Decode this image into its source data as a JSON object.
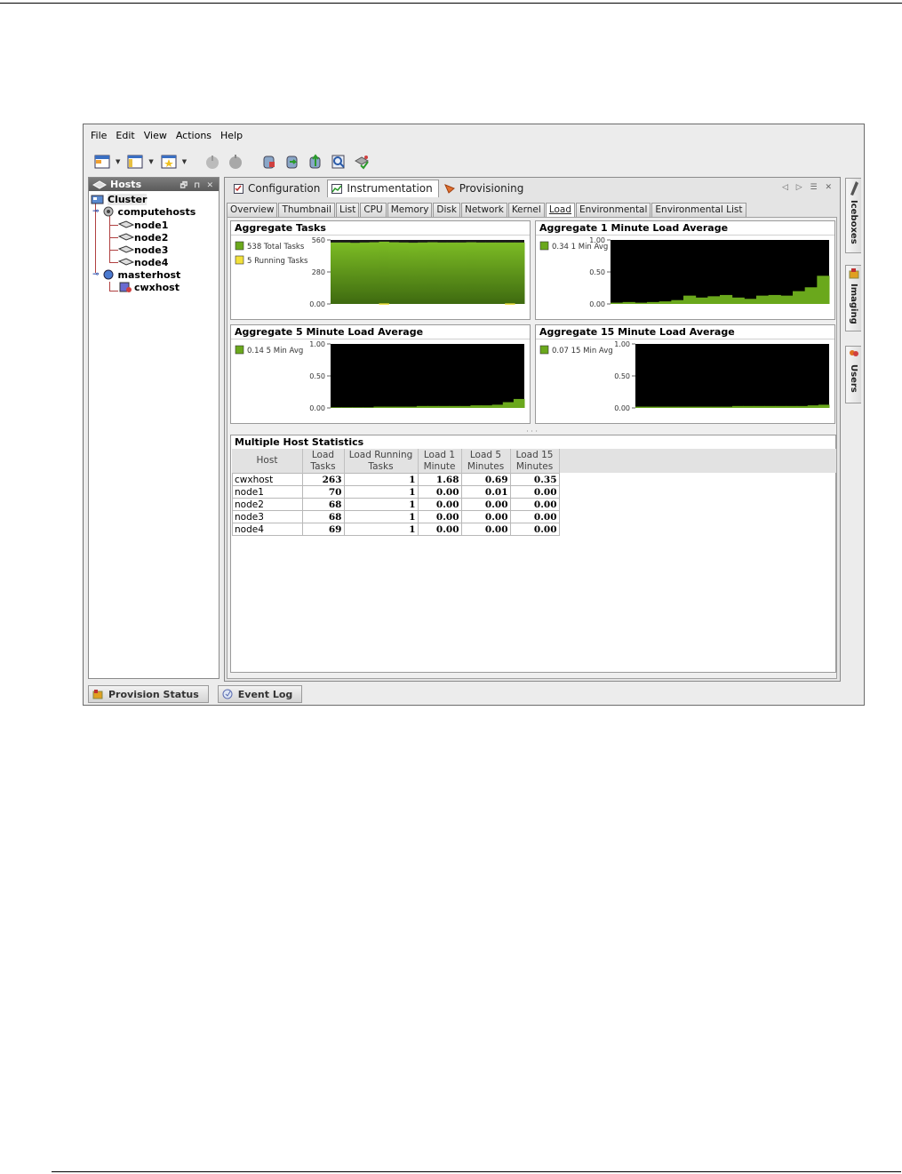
{
  "menu": [
    "File",
    "Edit",
    "View",
    "Actions",
    "Help"
  ],
  "hosts_panel": {
    "title": "Hosts",
    "tree": {
      "root": "Cluster",
      "group": "computehosts",
      "nodes": [
        "node1",
        "node2",
        "node3",
        "node4"
      ],
      "master": "masterhost",
      "master_child": "cwxhost"
    }
  },
  "view_tabs": [
    "Configuration",
    "Instrumentation",
    "Provisioning"
  ],
  "active_view_tab": "Instrumentation",
  "sub_tabs": [
    "Overview",
    "Thumbnail",
    "List",
    "CPU",
    "Memory",
    "Disk",
    "Network",
    "Kernel",
    "Load",
    "Environmental",
    "Environmental List"
  ],
  "active_sub_tab": "Load",
  "colors": {
    "series_green": "#6aa81c",
    "series_yellow": "#f2e03a",
    "plot_bg": "#000000"
  },
  "chart_data": [
    {
      "type": "area",
      "title": "Aggregate Tasks",
      "legend": [
        "538 Total Tasks",
        "5 Running Tasks"
      ],
      "yticks": [
        "560",
        "280",
        "0.00"
      ],
      "ylim": [
        0,
        560
      ],
      "series": [
        {
          "name": "538 Total Tasks",
          "values": [
            538,
            538,
            535,
            538,
            540,
            545,
            540,
            538,
            536,
            538,
            540,
            538,
            538,
            538,
            540,
            538,
            538,
            538,
            538,
            538
          ]
        },
        {
          "name": "5 Running Tasks",
          "values": [
            0,
            0,
            0,
            0,
            0,
            5,
            0,
            0,
            0,
            0,
            0,
            0,
            0,
            0,
            0,
            0,
            0,
            0,
            5,
            0
          ]
        }
      ]
    },
    {
      "type": "area",
      "title": "Aggregate 1 Minute Load Average",
      "legend": [
        "0.34 1 Min Avg"
      ],
      "yticks": [
        "1.00",
        "0.50",
        "0.00"
      ],
      "ylim": [
        0,
        1
      ],
      "series": [
        {
          "name": "0.34 1 Min Avg",
          "values": [
            0.02,
            0.03,
            0.02,
            0.03,
            0.04,
            0.06,
            0.13,
            0.1,
            0.12,
            0.14,
            0.1,
            0.08,
            0.13,
            0.14,
            0.13,
            0.2,
            0.26,
            0.44
          ]
        }
      ]
    },
    {
      "type": "area",
      "title": "Aggregate 5 Minute Load Average",
      "legend": [
        "0.14 5 Min Avg"
      ],
      "yticks": [
        "1.00",
        "0.50",
        "0.00"
      ],
      "ylim": [
        0,
        1
      ],
      "series": [
        {
          "name": "0.14 5 Min Avg",
          "values": [
            0.01,
            0.01,
            0.01,
            0.01,
            0.02,
            0.02,
            0.02,
            0.02,
            0.03,
            0.03,
            0.03,
            0.03,
            0.03,
            0.04,
            0.04,
            0.05,
            0.09,
            0.14
          ]
        }
      ]
    },
    {
      "type": "area",
      "title": "Aggregate 15 Minute Load Average",
      "legend": [
        "0.07 15 Min Avg"
      ],
      "yticks": [
        "1.00",
        "0.50",
        "0.00"
      ],
      "ylim": [
        0,
        1
      ],
      "series": [
        {
          "name": "0.07 15 Min Avg",
          "values": [
            0.02,
            0.02,
            0.02,
            0.02,
            0.02,
            0.02,
            0.02,
            0.02,
            0.02,
            0.03,
            0.03,
            0.03,
            0.03,
            0.03,
            0.03,
            0.03,
            0.04,
            0.05
          ]
        }
      ]
    }
  ],
  "stats": {
    "title": "Multiple Host Statistics",
    "headers": [
      [
        "Host"
      ],
      [
        "Load",
        "Tasks"
      ],
      [
        "Load Running",
        "Tasks"
      ],
      [
        "Load 1",
        "Minute"
      ],
      [
        "Load 5",
        "Minutes"
      ],
      [
        "Load 15",
        "Minutes"
      ]
    ],
    "rows": [
      [
        "cwxhost",
        "263",
        "1",
        "1.68",
        "0.69",
        "0.35"
      ],
      [
        "node1",
        "70",
        "1",
        "0.00",
        "0.01",
        "0.00"
      ],
      [
        "node2",
        "68",
        "1",
        "0.00",
        "0.00",
        "0.00"
      ],
      [
        "node3",
        "68",
        "1",
        "0.00",
        "0.00",
        "0.00"
      ],
      [
        "node4",
        "69",
        "1",
        "0.00",
        "0.00",
        "0.00"
      ]
    ]
  },
  "side_tabs": [
    "Iceboxes",
    "Imaging",
    "Users"
  ],
  "bottom_tabs": [
    "Provision Status",
    "Event Log"
  ]
}
